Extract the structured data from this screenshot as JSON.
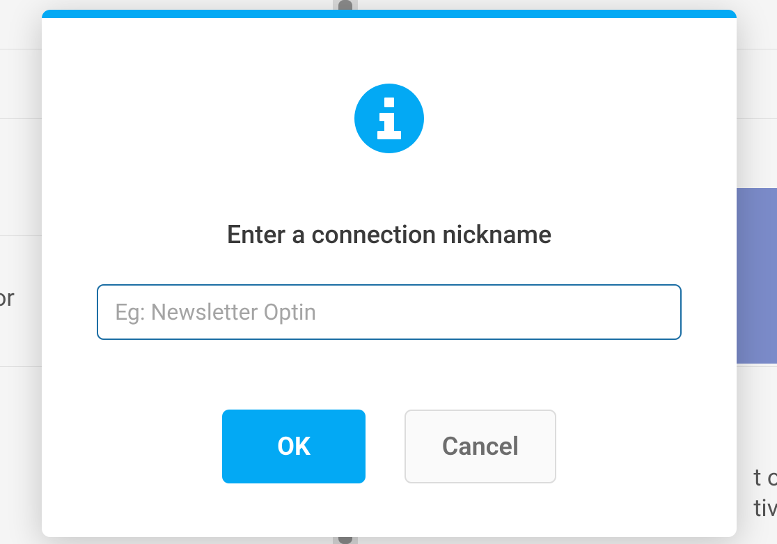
{
  "background": {
    "text_left": "or",
    "text_bottom_right_1": "t of",
    "text_bottom_right_2": "tive"
  },
  "modal": {
    "accent_color": "#03a9f4",
    "heading": "Enter a connection nickname",
    "input_placeholder": "Eg: Newsletter Optin",
    "input_value": "",
    "ok_label": "OK",
    "cancel_label": "Cancel"
  }
}
